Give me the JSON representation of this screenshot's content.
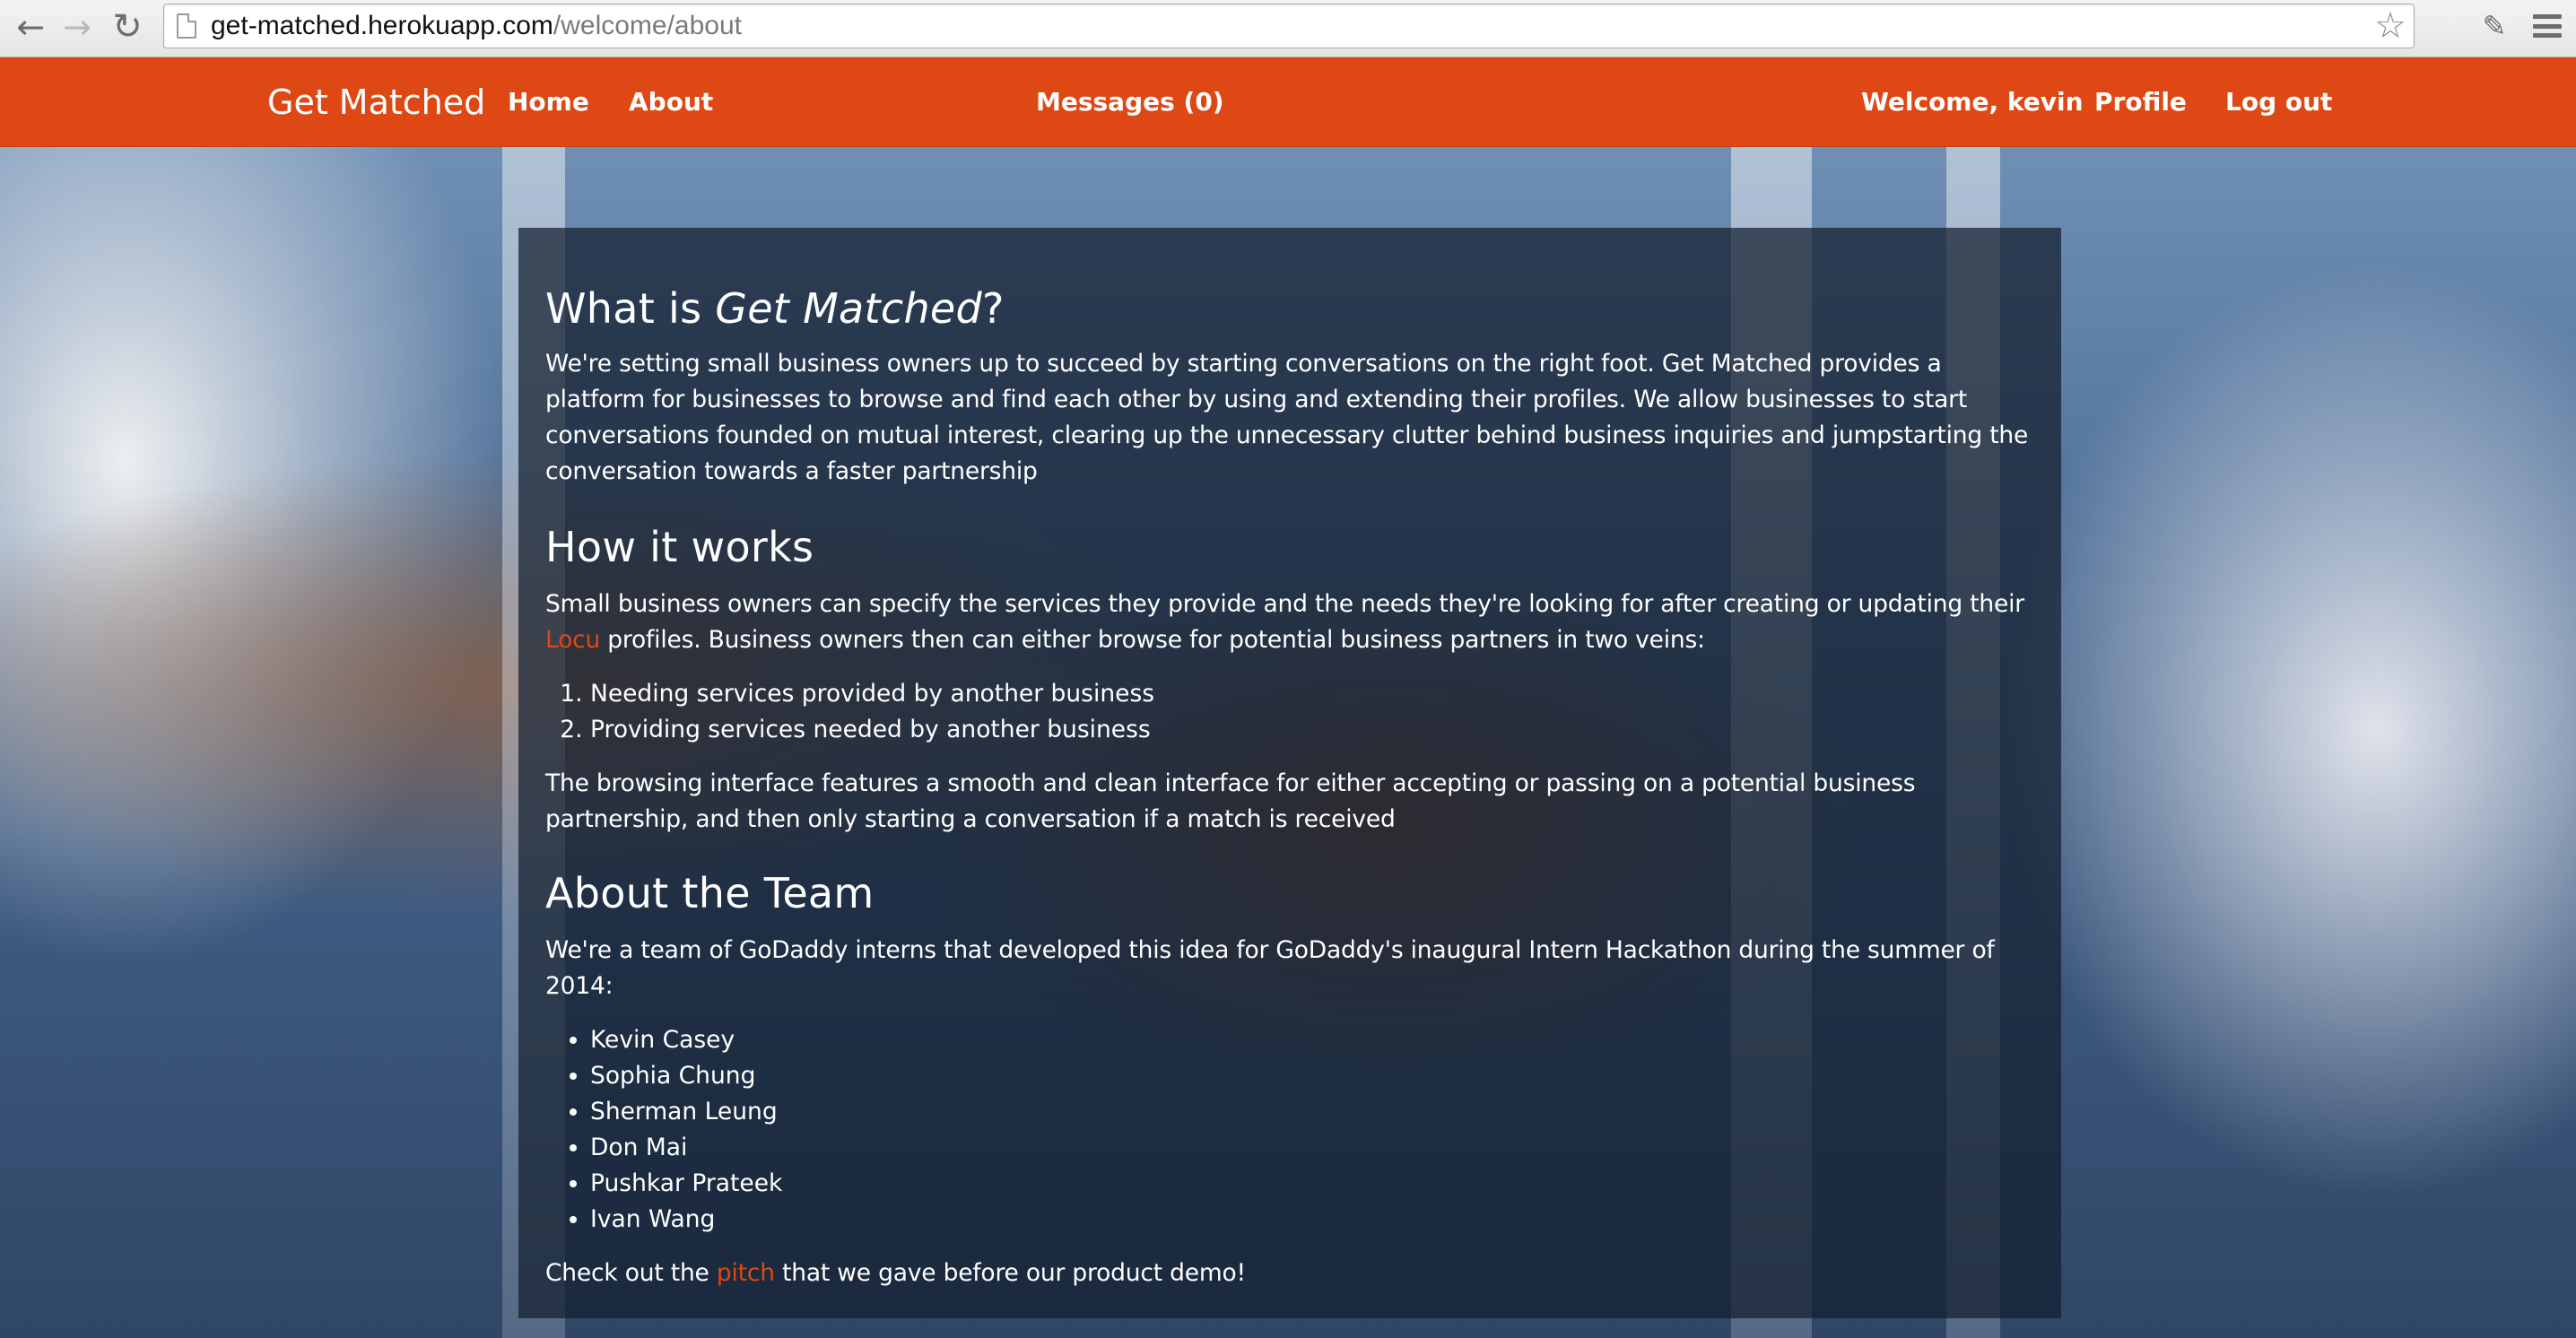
{
  "browser": {
    "url_host": "get-matched.herokuapp.com",
    "url_path": "/welcome/about"
  },
  "navbar": {
    "brand": "Get Matched",
    "home": "Home",
    "about": "About",
    "messages": "Messages (0)",
    "welcome": "Welcome, kevin",
    "profile": "Profile",
    "logout": "Log out"
  },
  "about": {
    "heading_prefix": "What is ",
    "heading_em": "Get Matched",
    "heading_suffix": "?",
    "paragraph": "We're setting small business owners up to succeed by starting conversations on the right foot. Get Matched provides a platform for businesses to browse and find each other by using and extending their profiles. We allow businesses to start conversations founded on mutual interest, clearing up the unnecessary clutter behind business inquiries and jumpstarting the conversation towards a faster partnership"
  },
  "how": {
    "heading": "How it works",
    "p1_before": "Small business owners can specify the services they provide and the needs they're looking for after creating or updating their ",
    "p1_link": "Locu",
    "p1_after": " profiles. Business owners then can either browse for potential business partners in two veins:",
    "steps": [
      "Needing services provided by another business",
      "Providing services needed by another business"
    ],
    "p2": "The browsing interface features a smooth and clean interface for either accepting or passing on a potential business partnership, and then only starting a conversation if a match is received"
  },
  "team": {
    "heading": "About the Team",
    "intro": "We're a team of GoDaddy interns that developed this idea for GoDaddy's inaugural Intern Hackathon during the summer of 2014:",
    "members": [
      "Kevin Casey",
      "Sophia Chung",
      "Sherman Leung",
      "Don Mai",
      "Pushkar Prateek",
      "Ivan Wang"
    ],
    "pitch_before": "Check out the ",
    "pitch_link": "pitch",
    "pitch_after": " that we gave before our product demo!"
  },
  "colors": {
    "navbar": "#dd4814",
    "link": "#dd4814"
  }
}
